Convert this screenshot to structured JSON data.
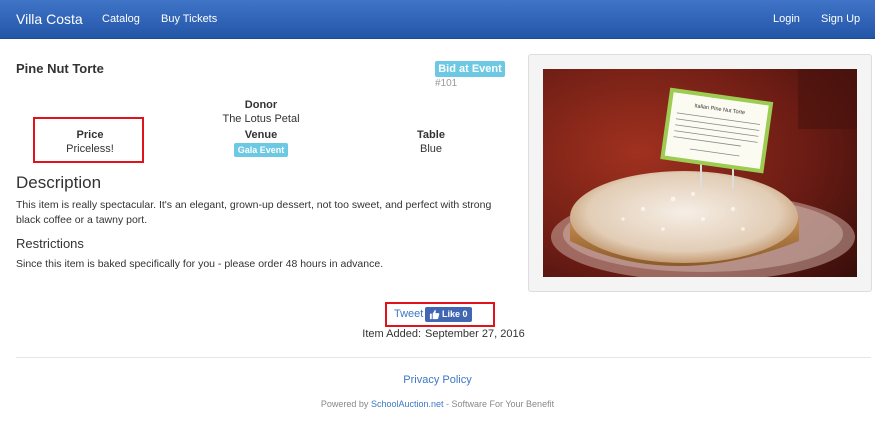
{
  "nav": {
    "brand": "Villa Costa",
    "links": [
      "Catalog",
      "Buy Tickets"
    ],
    "right_links": [
      "Login",
      "Sign Up"
    ],
    "bg_color": "#2f62b5"
  },
  "item": {
    "title": "Pine Nut Torte",
    "status_badge": "Bid at Event",
    "number": "#101",
    "donor_label": "Donor",
    "donor_value": "The Lotus Petal",
    "price_label": "Price",
    "price_value": "Priceless!",
    "venue_label": "Venue",
    "venue_badge": "Gala Event",
    "table_label": "Table",
    "table_value": "Blue"
  },
  "description": {
    "heading": "Description",
    "text": "This item is really spectacular.   It's an elegant, grown-up dessert, not too sweet, and perfect with strong black coffee or a tawny port."
  },
  "restrictions": {
    "heading": "Restrictions",
    "text": "Since this item is baked specifically for you - please order 48 hours in advance."
  },
  "photo": {
    "sign_text": "Italian Pine Nut Torte"
  },
  "social": {
    "tweet": "Tweet",
    "like": "Like 0"
  },
  "meta": {
    "added_label": "Item Added:",
    "added_date": "September 27, 2016"
  },
  "footer": {
    "privacy": "Privacy Policy",
    "powered_prefix": "Powered by",
    "powered_link": "SchoolAuction.net",
    "powered_suffix": " - Software For Your Benefit"
  }
}
